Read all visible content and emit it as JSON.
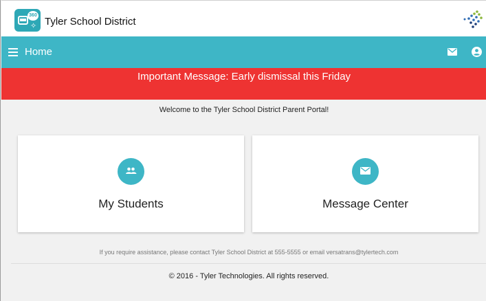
{
  "header": {
    "logo_text": "360",
    "district_title": "Tyler School District"
  },
  "nav": {
    "title": "Home",
    "icons": [
      "menu-icon",
      "mail-icon",
      "account-icon"
    ]
  },
  "alert": {
    "message": "Important Message: Early dismissal this Friday"
  },
  "main": {
    "welcome": "Welcome to the Tyler School District Parent Portal!",
    "cards": [
      {
        "label": "My Students",
        "icon": "people-icon"
      },
      {
        "label": "Message Center",
        "icon": "mail-icon"
      }
    ],
    "assistance": "If you require assistance, please contact Tyler School District at 555-5555 or email versatrans@tylertech.com"
  },
  "footer": {
    "copyright": "© 2016 - Tyler Technologies. All rights reserved."
  },
  "colors": {
    "nav_teal": "#3eb6c6",
    "alert_red": "#ee3332",
    "logo_teal": "#2ea8b6"
  }
}
